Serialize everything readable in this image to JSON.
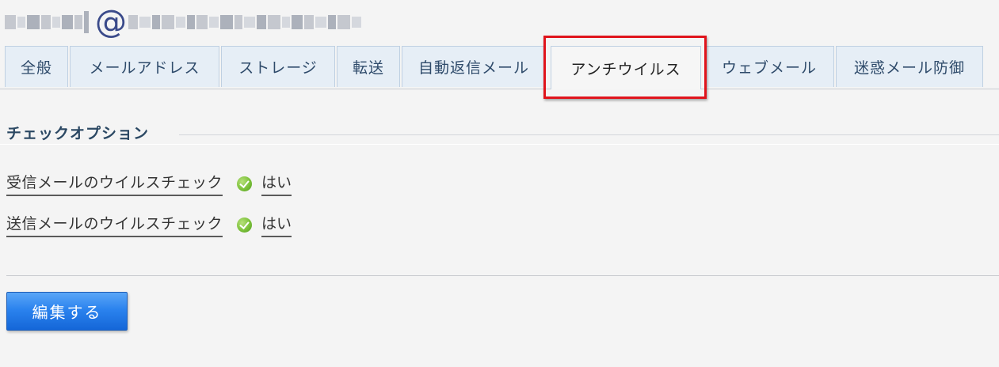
{
  "account": {
    "at_sign": "@"
  },
  "tabs": [
    {
      "label": "全般"
    },
    {
      "label": "メールアドレス"
    },
    {
      "label": "ストレージ"
    },
    {
      "label": "転送"
    },
    {
      "label": "自動返信メール"
    },
    {
      "label": "アンチウイルス",
      "active": true
    },
    {
      "label": "ウェブメール"
    },
    {
      "label": "迷惑メール防御"
    }
  ],
  "section": {
    "heading": "チェックオプション"
  },
  "options": [
    {
      "label": "受信メールのウイルスチェック",
      "icon": "check-circle-icon",
      "value": "はい"
    },
    {
      "label": "送信メールのウイルスチェック",
      "icon": "check-circle-icon",
      "value": "はい"
    }
  ],
  "actions": {
    "edit_label": "編集する"
  },
  "colors": {
    "accent_button": "#2b83ee",
    "highlight_box": "#e0141c",
    "tab_background": "#e6eef6",
    "check_green": "#7cc13a"
  }
}
